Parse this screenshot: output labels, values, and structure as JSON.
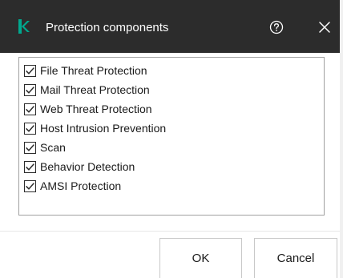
{
  "dialog": {
    "title": "Protection components",
    "logo_icon": "kaspersky-k-logo",
    "help_icon": "help-circle-icon",
    "close_icon": "close-icon",
    "accent_color": "#00a88e",
    "titlebar_color": "#2c2c2c"
  },
  "components": {
    "items": [
      {
        "label": "File Threat Protection",
        "checked": true
      },
      {
        "label": "Mail Threat Protection",
        "checked": true
      },
      {
        "label": "Web Threat Protection",
        "checked": true
      },
      {
        "label": "Host Intrusion Prevention",
        "checked": true
      },
      {
        "label": "Scan",
        "checked": true
      },
      {
        "label": "Behavior Detection",
        "checked": true
      },
      {
        "label": "AMSI Protection",
        "checked": true
      }
    ]
  },
  "buttons": {
    "ok_label": "OK",
    "cancel_label": "Cancel"
  }
}
